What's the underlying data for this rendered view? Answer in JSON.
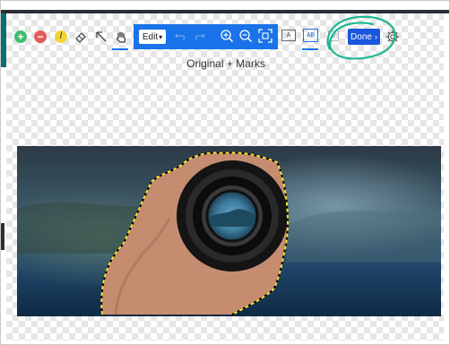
{
  "toolbar": {
    "add_icon": "plus-circle-icon",
    "remove_icon": "minus-circle-icon",
    "pencil_icon": "pencil-icon",
    "eraser_icon": "eraser-icon",
    "select_icon": "select-icon",
    "pan_icon": "hand-icon",
    "mode_select_value": "Edit",
    "zoom_in_icon": "zoom-in-icon",
    "zoom_out_icon": "zoom-out-icon",
    "fit_icon": "fit-screen-icon",
    "view_original_label": "A",
    "view_split_label": "AB",
    "done_label": "Done",
    "done_icon": "chevron-right-icon",
    "settings_icon": "gear-icon"
  },
  "view_title": "Original + Marks",
  "colors": {
    "accent": "#1a73e8",
    "done_button": "#1a56db",
    "add": "#3fbf6f",
    "remove": "#e35b5b",
    "pencil": "#f2d530",
    "annotation_ring": "#1fb894",
    "selection_dash": "#f3e33a"
  }
}
